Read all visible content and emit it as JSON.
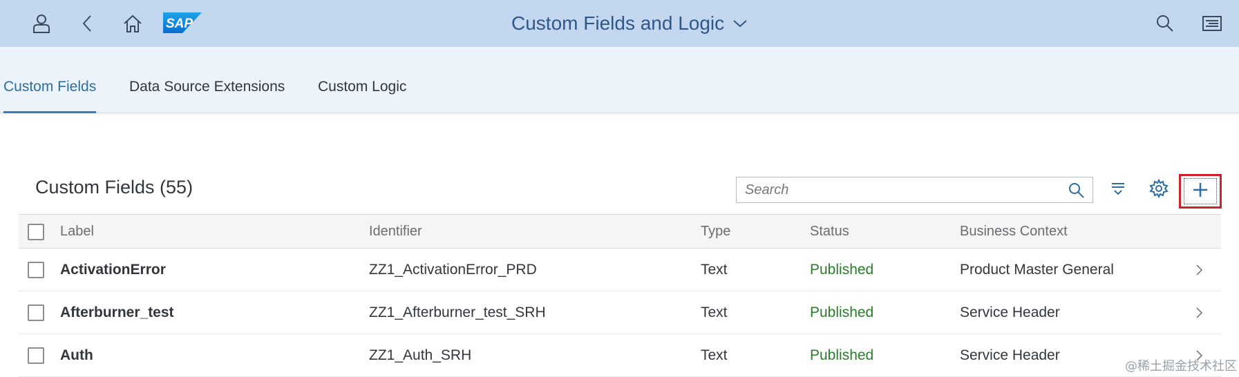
{
  "shell": {
    "logo_text": "SAP",
    "title": "Custom Fields and Logic",
    "icons": [
      "user-icon",
      "back-icon",
      "home-icon",
      "search-icon",
      "menu-icon"
    ]
  },
  "tabs": [
    {
      "label": "Custom Fields",
      "active": true
    },
    {
      "label": "Data Source Extensions",
      "active": false
    },
    {
      "label": "Custom Logic",
      "active": false
    }
  ],
  "table_toolbar": {
    "title": "Custom Fields (55)",
    "search_placeholder": "Search",
    "icons": [
      "search-icon",
      "sort-icon",
      "settings-icon",
      "add-icon"
    ]
  },
  "table": {
    "columns": [
      "Label",
      "Identifier",
      "Type",
      "Status",
      "Business Context"
    ],
    "rows": [
      {
        "label": "ActivationError",
        "identifier": "ZZ1_ActivationError_PRD",
        "type": "Text",
        "status": "Published",
        "context": "Product Master General"
      },
      {
        "label": "Afterburner_test",
        "identifier": "ZZ1_Afterburner_test_SRH",
        "type": "Text",
        "status": "Published",
        "context": "Service Header"
      },
      {
        "label": "Auth",
        "identifier": "ZZ1_Auth_SRH",
        "type": "Text",
        "status": "Published",
        "context": "Service Header"
      }
    ]
  },
  "colors": {
    "shell_bg": "#c3d8ee",
    "tab_active": "#2b6da3",
    "status_published": "#2b7c2b",
    "highlight_border": "#d0212a"
  },
  "watermark": "@稀土掘金技术社区"
}
